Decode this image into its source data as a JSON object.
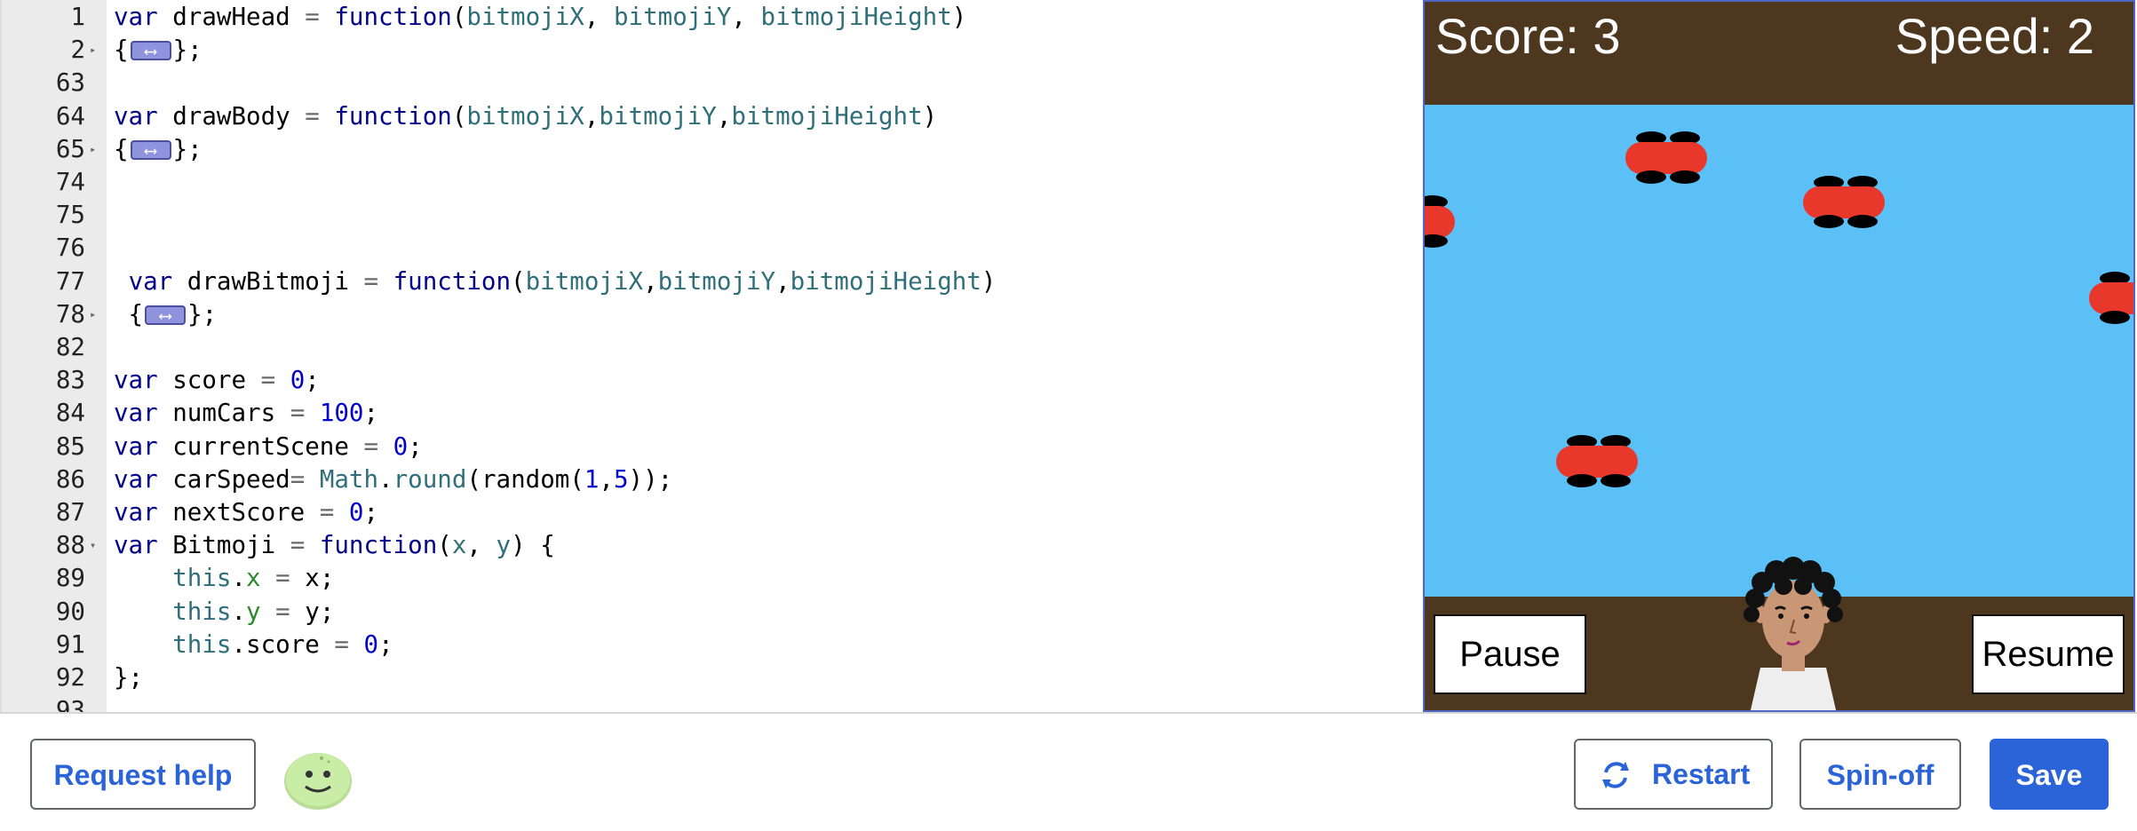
{
  "editor": {
    "lines": [
      {
        "num": "1",
        "fold": "",
        "tokens": [
          [
            "kw",
            "var"
          ],
          [
            "",
            " drawHead "
          ],
          [
            "op",
            "="
          ],
          [
            "",
            " "
          ],
          [
            "fn",
            "function"
          ],
          [
            "",
            "("
          ],
          [
            "param",
            "bitmojiX"
          ],
          [
            "",
            ", "
          ],
          [
            "param",
            "bitmojiY"
          ],
          [
            "",
            ", "
          ],
          [
            "param",
            "bitmojiHeight"
          ],
          [
            "",
            ")"
          ]
        ]
      },
      {
        "num": "2",
        "fold": "▸",
        "tokens": [
          [
            "",
            "{"
          ],
          [
            "widget",
            ""
          ],
          [
            "",
            "};"
          ]
        ]
      },
      {
        "num": "63",
        "fold": "",
        "tokens": []
      },
      {
        "num": "64",
        "fold": "",
        "tokens": [
          [
            "kw",
            "var"
          ],
          [
            "",
            " drawBody "
          ],
          [
            "op",
            "="
          ],
          [
            "",
            " "
          ],
          [
            "fn",
            "function"
          ],
          [
            "",
            "("
          ],
          [
            "param",
            "bitmojiX"
          ],
          [
            "",
            ","
          ],
          [
            "param",
            "bitmojiY"
          ],
          [
            "",
            ","
          ],
          [
            "param",
            "bitmojiHeight"
          ],
          [
            "",
            ")"
          ]
        ]
      },
      {
        "num": "65",
        "fold": "▸",
        "tokens": [
          [
            "",
            "{"
          ],
          [
            "widget",
            ""
          ],
          [
            "",
            "};"
          ]
        ]
      },
      {
        "num": "74",
        "fold": "",
        "tokens": []
      },
      {
        "num": "75",
        "fold": "",
        "tokens": []
      },
      {
        "num": "76",
        "fold": "",
        "tokens": []
      },
      {
        "num": "77",
        "fold": "",
        "tokens": [
          [
            "",
            " "
          ],
          [
            "kw",
            "var"
          ],
          [
            "",
            " drawBitmoji "
          ],
          [
            "op",
            "="
          ],
          [
            "",
            " "
          ],
          [
            "fn",
            "function"
          ],
          [
            "",
            "("
          ],
          [
            "param",
            "bitmojiX"
          ],
          [
            "",
            ","
          ],
          [
            "param",
            "bitmojiY"
          ],
          [
            "",
            ","
          ],
          [
            "param",
            "bitmojiHeight"
          ],
          [
            "",
            ")"
          ]
        ]
      },
      {
        "num": "78",
        "fold": "▸",
        "tokens": [
          [
            "",
            " {"
          ],
          [
            "widget",
            ""
          ],
          [
            "",
            "};"
          ]
        ]
      },
      {
        "num": "82",
        "fold": "",
        "tokens": []
      },
      {
        "num": "83",
        "fold": "",
        "tokens": [
          [
            "kw",
            "var"
          ],
          [
            "",
            " score "
          ],
          [
            "op",
            "="
          ],
          [
            "",
            " "
          ],
          [
            "num",
            "0"
          ],
          [
            "",
            ";"
          ]
        ]
      },
      {
        "num": "84",
        "fold": "",
        "tokens": [
          [
            "kw",
            "var"
          ],
          [
            "",
            " numCars "
          ],
          [
            "op",
            "="
          ],
          [
            "",
            " "
          ],
          [
            "num",
            "100"
          ],
          [
            "",
            ";"
          ]
        ]
      },
      {
        "num": "85",
        "fold": "",
        "tokens": [
          [
            "kw",
            "var"
          ],
          [
            "",
            " currentScene "
          ],
          [
            "op",
            "="
          ],
          [
            "",
            " "
          ],
          [
            "num",
            "0"
          ],
          [
            "",
            ";"
          ]
        ]
      },
      {
        "num": "86",
        "fold": "",
        "tokens": [
          [
            "kw",
            "var"
          ],
          [
            "",
            " carSpeed"
          ],
          [
            "op",
            "="
          ],
          [
            "",
            " "
          ],
          [
            "math",
            "Math"
          ],
          [
            "",
            "."
          ],
          [
            "math",
            "round"
          ],
          [
            "",
            "(random("
          ],
          [
            "num",
            "1"
          ],
          [
            "",
            ","
          ],
          [
            "num",
            "5"
          ],
          [
            "",
            "));"
          ]
        ]
      },
      {
        "num": "87",
        "fold": "",
        "tokens": [
          [
            "kw",
            "var"
          ],
          [
            "",
            " nextScore "
          ],
          [
            "op",
            "="
          ],
          [
            "",
            " "
          ],
          [
            "num",
            "0"
          ],
          [
            "",
            ";"
          ]
        ]
      },
      {
        "num": "88",
        "fold": "▾",
        "tokens": [
          [
            "kw",
            "var"
          ],
          [
            "",
            " Bitmoji "
          ],
          [
            "op",
            "="
          ],
          [
            "",
            " "
          ],
          [
            "fn",
            "function"
          ],
          [
            "",
            "("
          ],
          [
            "param",
            "x"
          ],
          [
            "",
            ", "
          ],
          [
            "param",
            "y"
          ],
          [
            "",
            ") {"
          ]
        ]
      },
      {
        "num": "89",
        "fold": "",
        "tokens": [
          [
            "",
            "    "
          ],
          [
            "this",
            "this"
          ],
          [
            "",
            "."
          ],
          [
            "prop",
            "x"
          ],
          [
            "",
            " "
          ],
          [
            "op",
            "="
          ],
          [
            "",
            " x;"
          ]
        ]
      },
      {
        "num": "90",
        "fold": "",
        "tokens": [
          [
            "",
            "    "
          ],
          [
            "this",
            "this"
          ],
          [
            "",
            "."
          ],
          [
            "prop",
            "y"
          ],
          [
            "",
            " "
          ],
          [
            "op",
            "="
          ],
          [
            "",
            " y;"
          ]
        ]
      },
      {
        "num": "91",
        "fold": "",
        "tokens": [
          [
            "",
            "    "
          ],
          [
            "this",
            "this"
          ],
          [
            "",
            ".score "
          ],
          [
            "op",
            "="
          ],
          [
            "",
            " "
          ],
          [
            "num",
            "0"
          ],
          [
            "",
            ";"
          ]
        ]
      },
      {
        "num": "92",
        "fold": "",
        "tokens": [
          [
            "",
            "};"
          ]
        ]
      },
      {
        "num": "93",
        "fold": "",
        "tokens": []
      }
    ]
  },
  "game": {
    "score_text": "Score: 3",
    "speed_text": "Speed: 2",
    "pause_label": "Pause",
    "resume_label": "Resume",
    "colors": {
      "sky": "#5bc0f6",
      "dirt": "#4d371e",
      "car": "#e8372b"
    },
    "icons": [
      "car-icon",
      "bitmoji-character"
    ]
  },
  "footer": {
    "request_help_label": "Request help",
    "restart_label": "Restart",
    "spin_off_label": "Spin-off",
    "save_label": "Save",
    "accent": "#2a64d8",
    "icons": [
      "restart-icon",
      "avatar-icon"
    ]
  }
}
